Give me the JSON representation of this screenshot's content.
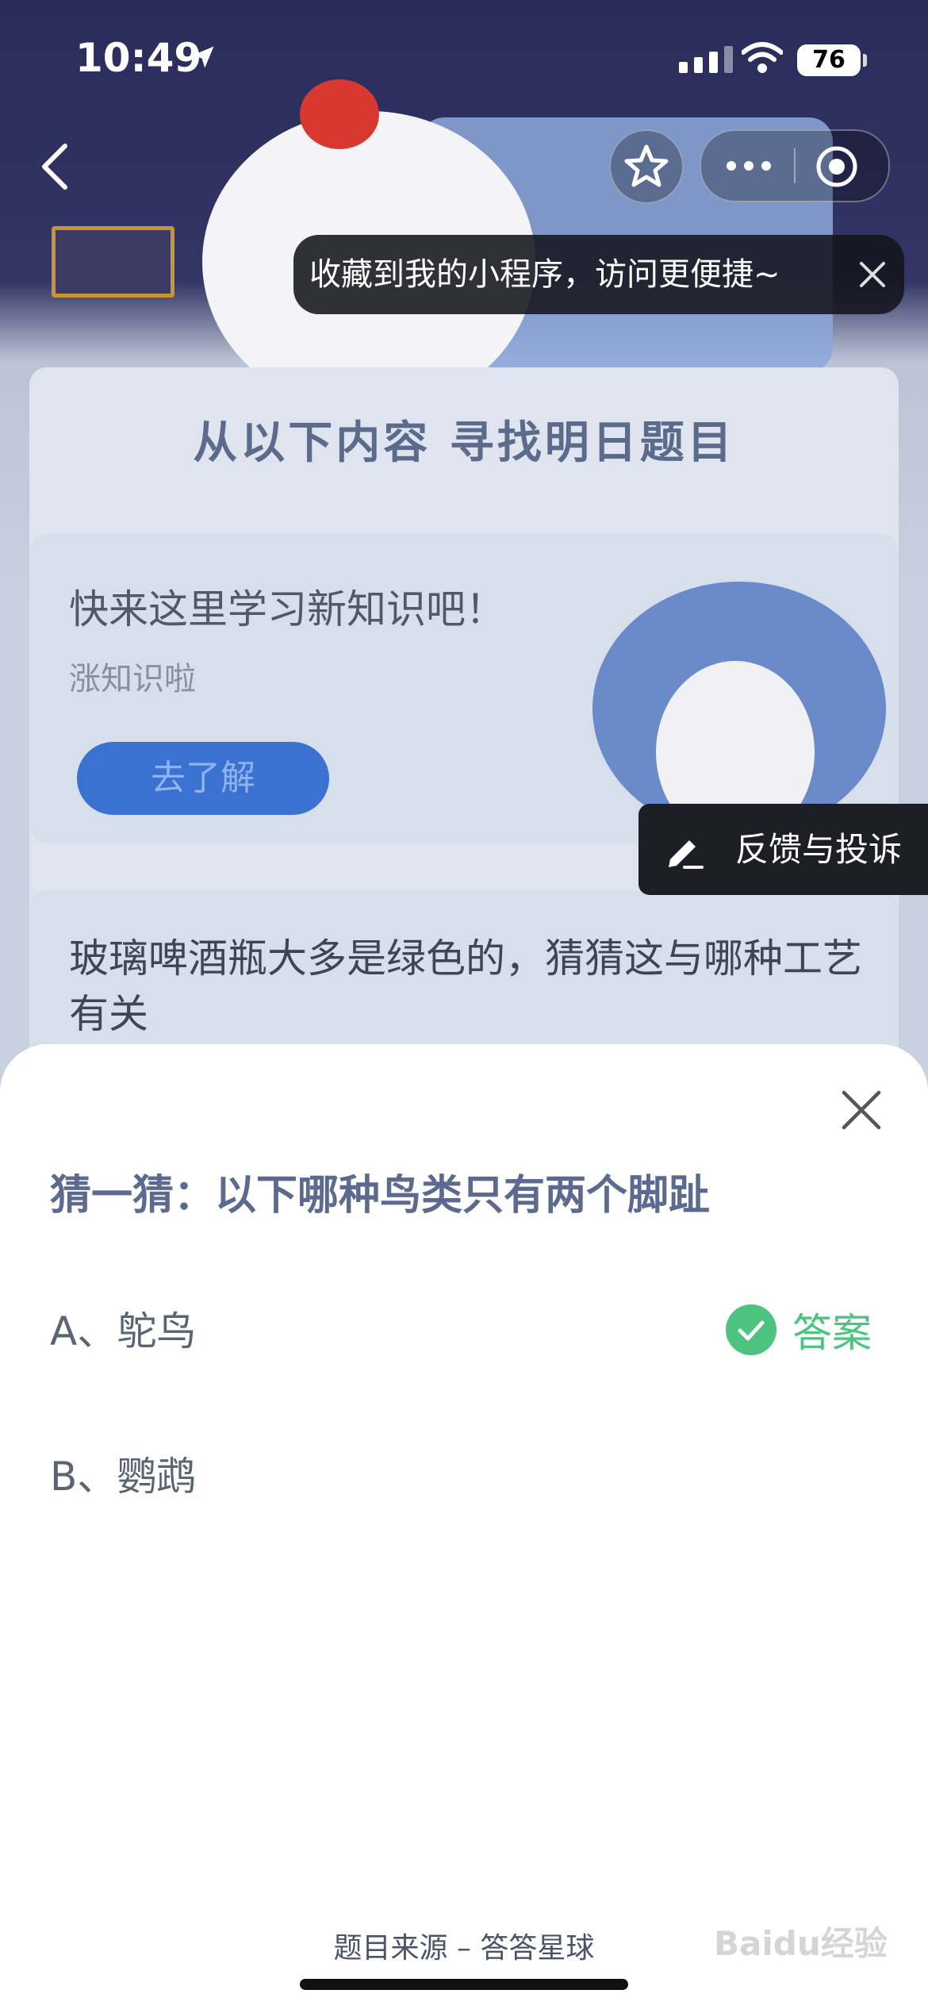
{
  "status_bar": {
    "time": "10:49",
    "battery": "76"
  },
  "tooltip": {
    "text": "收藏到我的小程序，访问更便捷~"
  },
  "page": {
    "section_title": "从以下内容 寻找明日题目",
    "learn_card": {
      "title": "快来这里学习新知识吧！",
      "subtitle": "涨知识啦",
      "button": "去了解"
    },
    "question_card": {
      "text": "玻璃啤酒瓶大多是绿色的，猜猜这与哪种工艺有关"
    },
    "feedback": "反馈与投诉"
  },
  "sheet": {
    "title": "猜一猜：以下哪种鸟类只有两个脚趾",
    "options": [
      {
        "label": "A、鸵鸟",
        "is_answer": true
      },
      {
        "label": "B、鹦鹉",
        "is_answer": false
      }
    ],
    "answer_label": "答案",
    "source": "题目来源 – 答答星球"
  },
  "watermark": "Baidu经验",
  "colors": {
    "accent_green": "#4cc37f",
    "title_blue": "#5b6a8e",
    "button_blue": "#3b72d2"
  },
  "icons": [
    "location-arrow-icon",
    "signal-icon",
    "wifi-icon",
    "battery-icon",
    "back-icon",
    "star-icon",
    "more-icon",
    "target-icon",
    "close-icon",
    "edit-icon",
    "check-icon"
  ]
}
